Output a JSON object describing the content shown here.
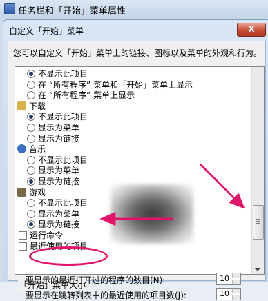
{
  "window": {
    "title": "任务栏和「开始」菜单属性"
  },
  "dialog": {
    "title": "自定义「开始」菜单",
    "close_label": "X",
    "description": "您可以自定义「开始」菜单上的链接、图标以及菜单的外观和行为。"
  },
  "options": [
    {
      "type": "radio",
      "label": "不显示此项目",
      "checked": true
    },
    {
      "type": "radio",
      "label": "在 “所有程序” 菜单和「开始」菜单上显示",
      "checked": false
    },
    {
      "type": "radio",
      "label": "在 “所有程序” 菜单上显示",
      "checked": false
    },
    {
      "type": "category",
      "label": "下载",
      "icon": "downloads-folder-icon"
    },
    {
      "type": "radio",
      "label": "不显示此项目",
      "checked": true
    },
    {
      "type": "radio",
      "label": "显示为菜单",
      "checked": false
    },
    {
      "type": "radio",
      "label": "显示为链接",
      "checked": false
    },
    {
      "type": "category",
      "label": "音乐",
      "icon": "music-icon"
    },
    {
      "type": "radio",
      "label": "不显示此项目",
      "checked": false
    },
    {
      "type": "radio",
      "label": "显示为菜单",
      "checked": false
    },
    {
      "type": "radio",
      "label": "显示为链接",
      "checked": true
    },
    {
      "type": "category",
      "label": "游戏",
      "icon": "games-icon"
    },
    {
      "type": "radio",
      "label": "不显示此项目",
      "checked": false
    },
    {
      "type": "radio",
      "label": "显示为菜单",
      "checked": false
    },
    {
      "type": "radio",
      "label": "显示为链接",
      "checked": true
    },
    {
      "type": "checkbox",
      "label": "运行命令",
      "checked": false
    },
    {
      "type": "checkbox",
      "label": "最近使用的项目",
      "checked": false
    }
  ],
  "menu_size": {
    "group_title": "「开始」菜单大小",
    "recent_programs_label": "要显示的最近打开过的程序的数目(N):",
    "recent_programs_value": "10",
    "jump_list_label": "要显示在跳转列表中的最近使用的项目数(J):",
    "jump_list_value": "10"
  },
  "colors": {
    "annotation": "#e3136b",
    "close_button": "#c94b33"
  }
}
